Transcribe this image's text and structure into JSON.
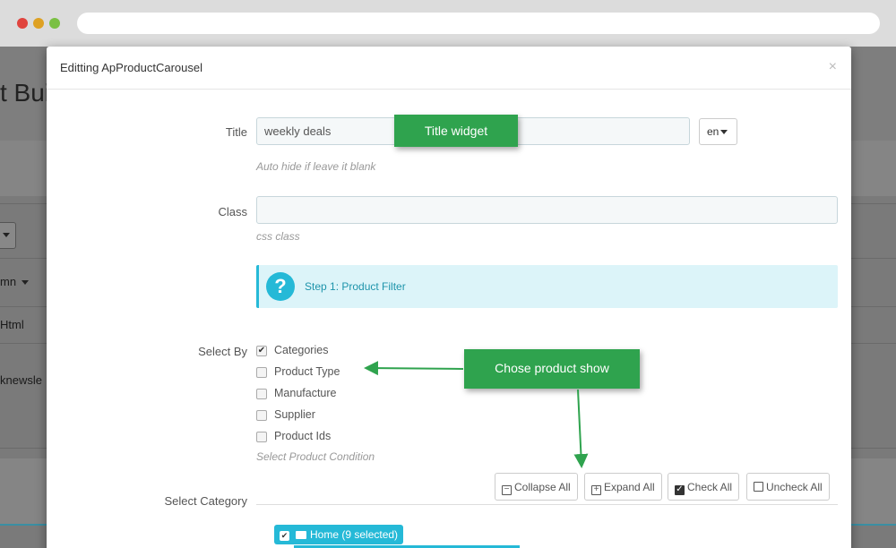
{
  "browser": {},
  "background": {
    "title_fragment": "t Bui",
    "row1": "Html",
    "row2": "knewsle",
    "column_select": "mn"
  },
  "modal": {
    "title": "Editting ApProductCarousel",
    "close": "×",
    "title_field": {
      "label": "Title",
      "value": "weekly deals",
      "lang": "en",
      "help": "Auto hide if leave it blank"
    },
    "class_field": {
      "label": "Class",
      "value": "",
      "help": "css class"
    },
    "step_info": {
      "icon": "question-icon",
      "text": "Step 1: Product Filter"
    },
    "select_by": {
      "label": "Select By",
      "options": [
        {
          "label": "Categories",
          "checked": true
        },
        {
          "label": "Product Type",
          "checked": false
        },
        {
          "label": "Manufacture",
          "checked": false
        },
        {
          "label": "Supplier",
          "checked": false
        },
        {
          "label": "Product Ids",
          "checked": false
        }
      ],
      "help": "Select Product Condition"
    },
    "select_category": {
      "label": "Select Category",
      "buttons": {
        "collapse_all": "Collapse All",
        "expand_all": "Expand All",
        "check_all": "Check All",
        "uncheck_all": "Uncheck All"
      },
      "root_node": "Home (9 selected)"
    }
  },
  "annotations": {
    "title_widget": "Title widget",
    "chose_product_show": "Chose product show"
  },
  "colors": {
    "accent": "#25b9d7",
    "callout": "#2fa34e",
    "info_bg": "#dcf4f9"
  }
}
